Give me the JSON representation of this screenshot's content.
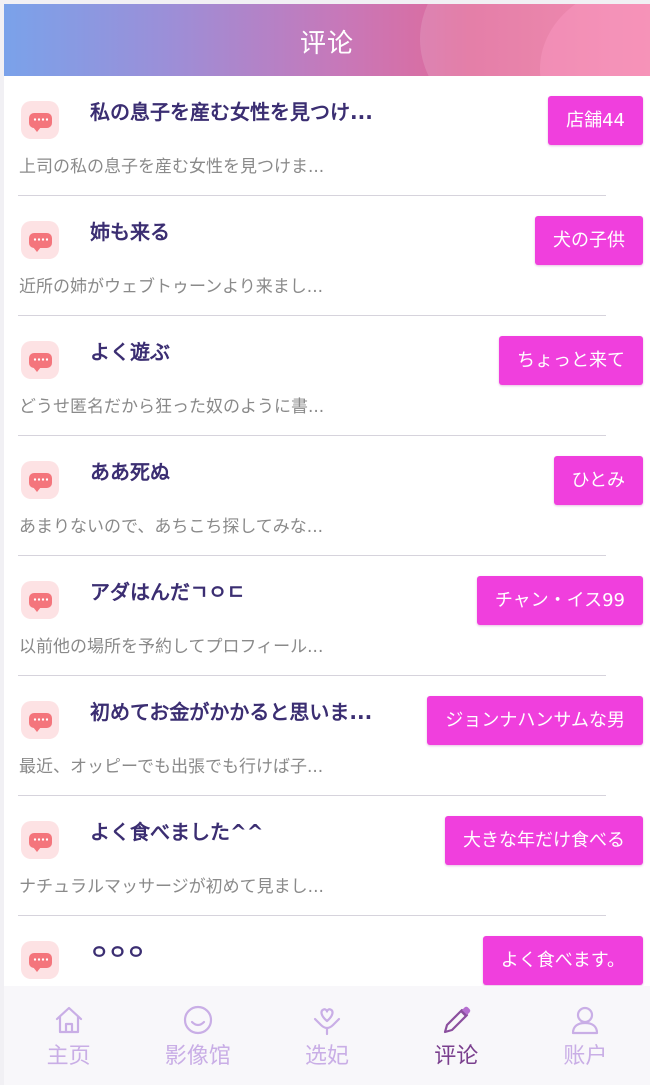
{
  "header": {
    "title": "评论"
  },
  "comments": [
    {
      "title": "私の息子を産む女性を見つけ...",
      "preview": "上司の私の息子を産む女性を見つけま...",
      "tag": "店舗44"
    },
    {
      "title": "姉も来る",
      "preview": "近所の姉がウェブトゥーンより来まし...",
      "tag": "犬の子供"
    },
    {
      "title": "よく遊ぶ",
      "preview": "どうせ匿名だから狂った奴のように書...",
      "tag": "ちょっと来て"
    },
    {
      "title": "ああ死ぬ",
      "preview": "あまりないので、あちこち探してみな...",
      "tag": "ひとみ"
    },
    {
      "title": "アダはんだㄱㅇㄷ",
      "preview": "以前他の場所を予約してプロフィール...",
      "tag": "チャン・イス99"
    },
    {
      "title": "初めてお金がかかると思いま...",
      "preview": "最近、オッピーでも出張でも行けば子...",
      "tag": "ジョンナハンサムな男"
    },
    {
      "title": "よく食べました^^",
      "preview": "ナチュラルマッサージが初めて見まし...",
      "tag": "大きな年だけ食べる"
    },
    {
      "title": "ㅇㅇㅇ",
      "preview": "",
      "tag": "よく食べます。"
    }
  ],
  "tabbar": {
    "tabs": [
      {
        "label": "主页",
        "icon": "home-icon"
      },
      {
        "label": "影像馆",
        "icon": "smile-icon"
      },
      {
        "label": "选妃",
        "icon": "heart-hand-icon"
      },
      {
        "label": "评论",
        "icon": "pencil-icon",
        "active": true
      },
      {
        "label": "账户",
        "icon": "user-icon"
      }
    ]
  },
  "colors": {
    "tag_bg": "#f03fdd",
    "title_text": "#3b2e72",
    "tab_inactive": "#c9aee6",
    "tab_active": "#7a3f8e"
  }
}
